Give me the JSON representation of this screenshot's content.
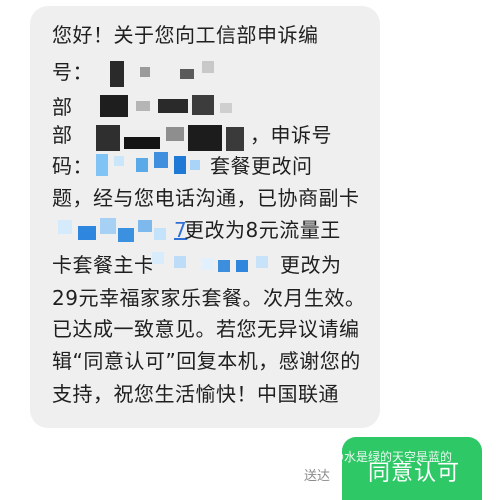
{
  "message": {
    "lines": [
      "您好！关于您向工信部申诉编",
      "号：",
      "部",
      "部",
      "，申诉号",
      "码：",
      "套餐更改问",
      "题，经与您电话沟通，已协商副卡",
      "7",
      "更改为8元流量王",
      "卡套餐主卡",
      "更改为",
      "29元幸福家家乐套餐。次月生效。",
      "已达成一致意见。若您无异议请编",
      "辑“同意认可”回复本机，感谢您的",
      "支持，祝您生活愉快！中国联通"
    ]
  },
  "status": {
    "sent": "送达"
  },
  "reply": {
    "text": "同意认可"
  },
  "watermark": {
    "text": "@水是绿的天空是蓝的"
  },
  "colors": {
    "bubble": "#efefef",
    "reply": "#2ec866",
    "link": "#2f6fd6"
  }
}
